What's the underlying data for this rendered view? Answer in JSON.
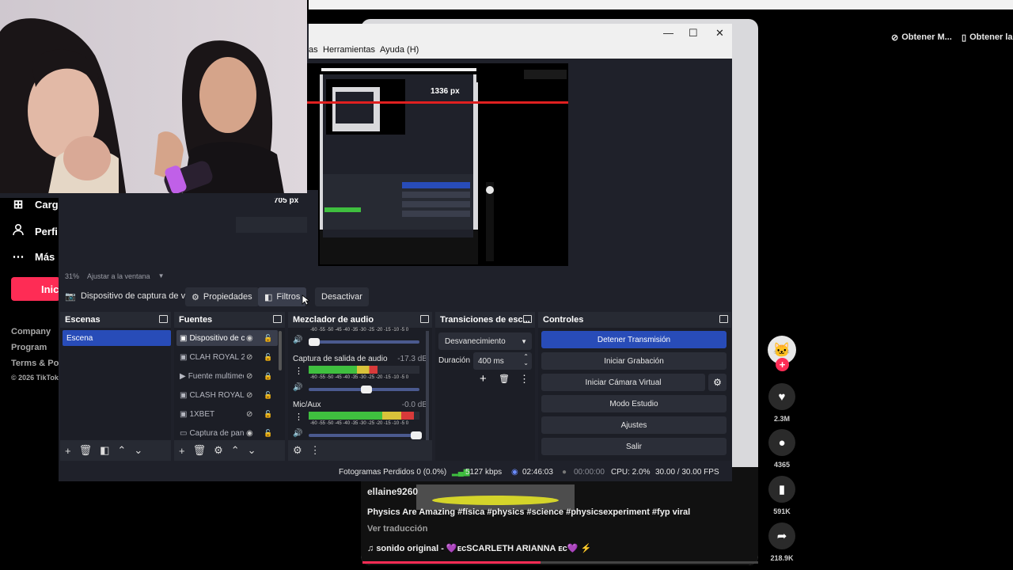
{
  "tiktok": {
    "top_buttons": [
      "Obtener M...",
      "Obtener la"
    ],
    "nav": [
      {
        "icon": "upload-icon",
        "label": "Carg"
      },
      {
        "icon": "profile-icon",
        "label": "Perfi"
      },
      {
        "icon": "more-icon",
        "label": "Más"
      }
    ],
    "login_label": "Inici",
    "footer": [
      "Company",
      "Program",
      "Terms & Pol",
      "© 2026 TikTok"
    ],
    "author": "ellaine9260",
    "description": "Physics Are Amazing #física #physics #science #physicsexperiment #fyp viral",
    "translate_label": "Ver traducción",
    "sound": "sonido original - 💜ᴇᴄSCARLETH ARIANNA ᴇᴄ💜 ⚡",
    "progress": 0.45,
    "actions": [
      {
        "icon": "heart-icon",
        "count": "2.3M"
      },
      {
        "icon": "comment-icon",
        "count": "4365"
      },
      {
        "icon": "bookmark-icon",
        "count": "591K"
      },
      {
        "icon": "share-icon",
        "count": "218.9K"
      }
    ]
  },
  "obs": {
    "menu": [
      "as",
      "Herramientas",
      "Ayuda (H)"
    ],
    "preview": {
      "label_width": "1336 px",
      "label_height": "705 px"
    },
    "zoom": {
      "percent": "31%",
      "mode": "Ajustar a la ventana"
    },
    "source_toolbar": {
      "source_name": "Dispositivo de captura de v",
      "properties": "Propiedades",
      "filters": "Filtros",
      "deactivate": "Desactivar"
    },
    "docks": {
      "scenes": {
        "title": "Escenas",
        "items": [
          "Escena"
        ]
      },
      "sources": {
        "title": "Fuentes",
        "items": [
          {
            "name": "Dispositivo de c",
            "icon": "camera-icon",
            "visible": true,
            "locked": false
          },
          {
            "name": "CLAH ROYAL 2",
            "icon": "image-icon",
            "visible": false,
            "locked": false
          },
          {
            "name": "Fuente multimedia",
            "icon": "play-icon",
            "visible": false,
            "locked": true
          },
          {
            "name": "CLASH ROYAL",
            "icon": "image-icon",
            "visible": false,
            "locked": false
          },
          {
            "name": "1XBET",
            "icon": "image-icon",
            "visible": false,
            "locked": false
          },
          {
            "name": "Captura de pan",
            "icon": "monitor-icon",
            "visible": true,
            "locked": false
          }
        ]
      },
      "mixer": {
        "title": "Mezclador de audio",
        "scale": "-60 -55 -50 -45 -40 -35 -30 -25 -20 -15 -10 -5 0",
        "channels": [
          {
            "name": "",
            "db": "",
            "level": 0.0,
            "fader": 0.05
          },
          {
            "name": "Captura de salida de audio",
            "db": "-17.3 dB",
            "level": 0.62,
            "fader": 0.52
          },
          {
            "name": "Mic/Aux",
            "db": "-0.0 dB",
            "level": 0.95,
            "fader": 0.97
          }
        ]
      },
      "transitions": {
        "title": "Transiciones de esc...",
        "selected": "Desvanecimiento",
        "duration_label": "Duración",
        "duration_value": "400 ms"
      },
      "controls": {
        "title": "Controles",
        "buttons": [
          "Detener Transmisión",
          "Iniciar Grabación",
          "Iniciar Cámara Virtual",
          "Modo Estudio",
          "Ajustes",
          "Salir"
        ]
      }
    },
    "status": {
      "dropped": "Fotogramas Perdidos 0 (0.0%)",
      "bitrate": "5127 kbps",
      "stream_time": "02:46:03",
      "rec_time": "00:00:00",
      "cpu": "CPU: 2.0%",
      "fps": "30.00 / 30.00 FPS"
    }
  },
  "colors": {
    "tiktok_red": "#fe2c55",
    "obs_blue": "#284cb8",
    "obs_bg": "#1f212a"
  }
}
